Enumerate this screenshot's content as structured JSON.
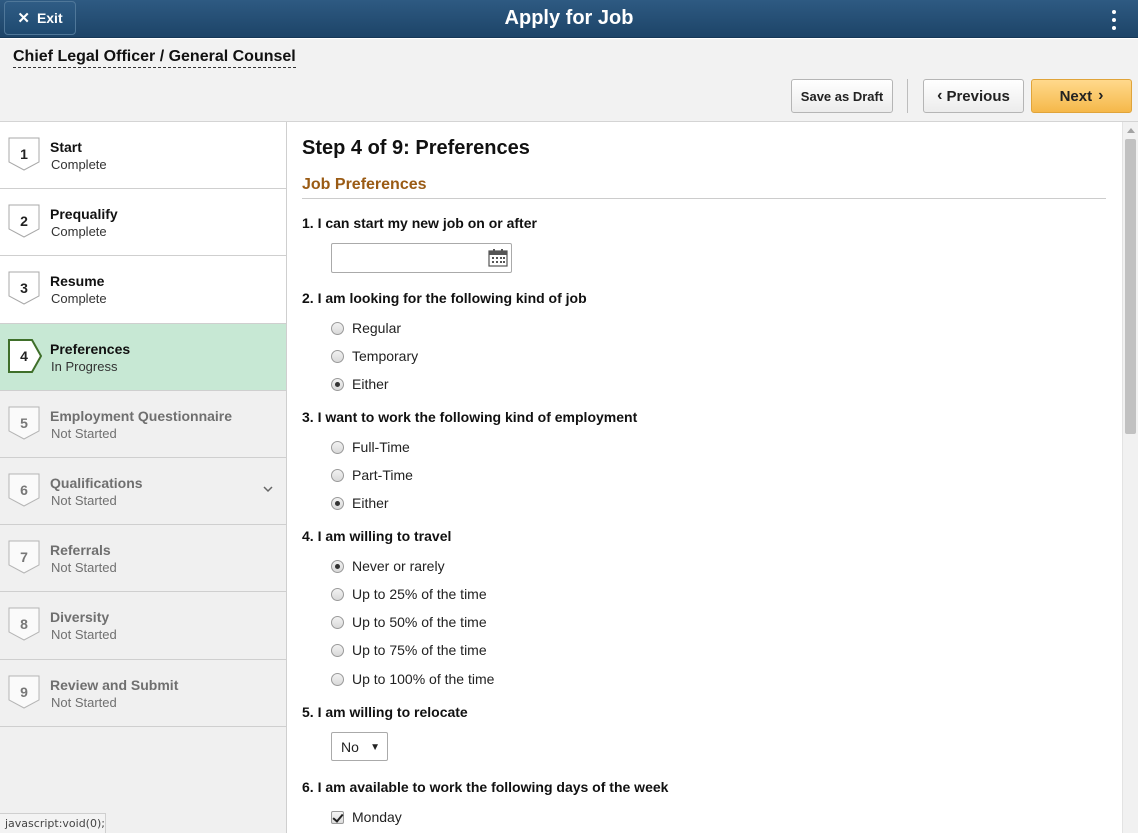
{
  "topbar": {
    "exit_label": "Exit",
    "title": "Apply for Job"
  },
  "header": {
    "job_title": "Chief Legal Officer / General Counsel",
    "save_draft_label": "Save as Draft",
    "previous_label": "Previous",
    "next_label": "Next"
  },
  "steps": [
    {
      "number": "1",
      "title": "Start",
      "status": "Complete"
    },
    {
      "number": "2",
      "title": "Prequalify",
      "status": "Complete"
    },
    {
      "number": "3",
      "title": "Resume",
      "status": "Complete"
    },
    {
      "number": "4",
      "title": "Preferences",
      "status": "In Progress"
    },
    {
      "number": "5",
      "title": "Employment Questionnaire",
      "status": "Not Started"
    },
    {
      "number": "6",
      "title": "Qualifications",
      "status": "Not Started"
    },
    {
      "number": "7",
      "title": "Referrals",
      "status": "Not Started"
    },
    {
      "number": "8",
      "title": "Diversity",
      "status": "Not Started"
    },
    {
      "number": "9",
      "title": "Review and Submit",
      "status": "Not Started"
    }
  ],
  "status_bar": "javascript:void(0);",
  "main": {
    "heading": "Step 4 of 9: Preferences",
    "section": "Job Preferences",
    "q1": {
      "label": "1. I can start my new job on or after",
      "value": ""
    },
    "q2": {
      "label": "2. I am looking for the following kind of job",
      "options": [
        "Regular",
        "Temporary",
        "Either"
      ],
      "selected": "Either"
    },
    "q3": {
      "label": "3. I want to work the following kind of employment",
      "options": [
        "Full-Time",
        "Part-Time",
        "Either"
      ],
      "selected": "Either"
    },
    "q4": {
      "label": "4. I am willing to travel",
      "options": [
        "Never or rarely",
        "Up to 25% of the time",
        "Up to 50% of the time",
        "Up to 75% of the time",
        "Up to 100% of the time"
      ],
      "selected": "Never or rarely"
    },
    "q5": {
      "label": "5. I am willing to relocate",
      "value": "No"
    },
    "q6": {
      "label": "6. I am available to work the following days of the week",
      "options": [
        "Monday"
      ],
      "checked": [
        "Monday"
      ]
    }
  }
}
